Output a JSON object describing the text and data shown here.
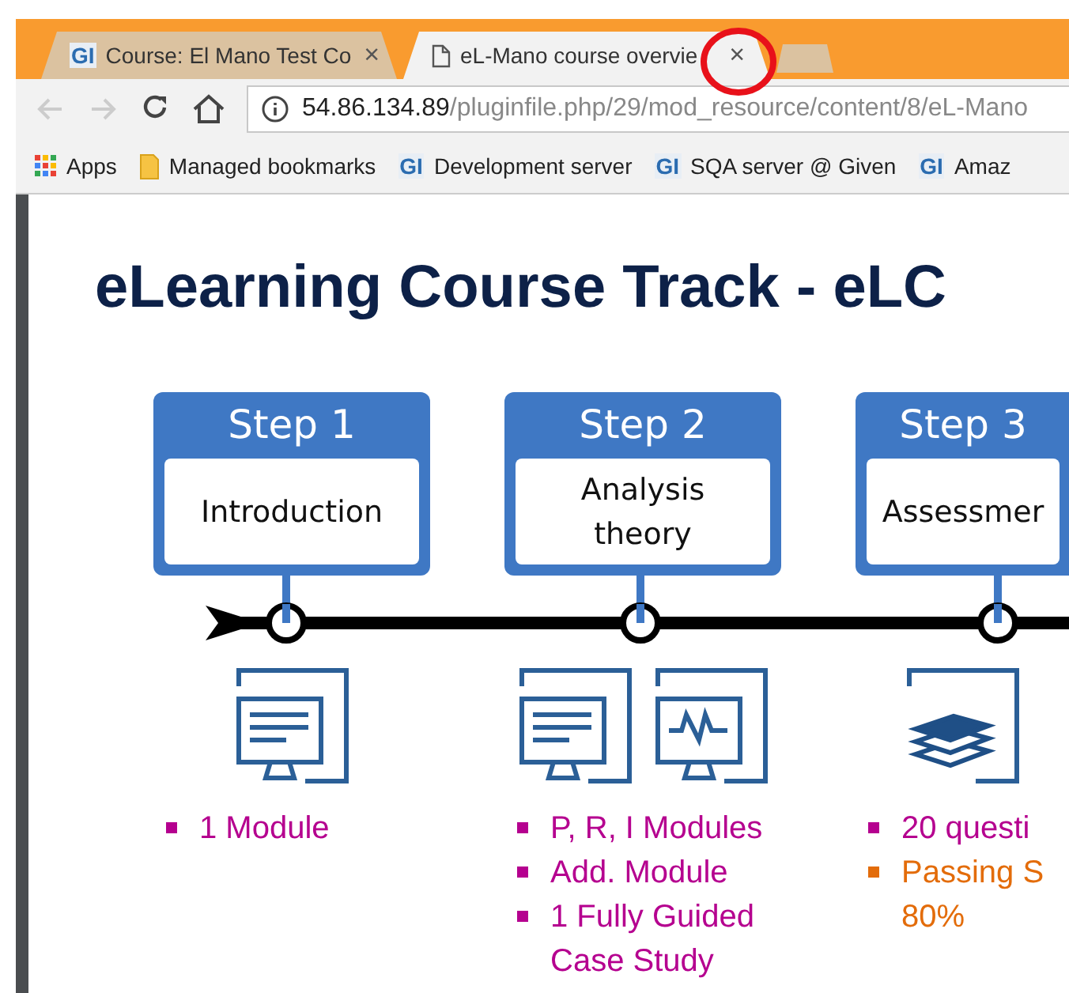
{
  "browser": {
    "tabs": [
      {
        "favicon": {
          "kind": "badge",
          "text": "GI"
        },
        "title": "Course: El Mano Test Co",
        "close": "×",
        "selected": false
      },
      {
        "favicon": {
          "kind": "page"
        },
        "title": "eL-Mano course overvie",
        "close": "×",
        "selected": true
      }
    ],
    "nav": {
      "back_disabled": true,
      "forward_disabled": true
    },
    "url": {
      "host": "54.86.134.89",
      "path": "/pluginfile.php/29/mod_resource/content/8/eL-Mano"
    },
    "bookmarks": [
      {
        "kind": "apps",
        "label": "Apps"
      },
      {
        "kind": "folder",
        "label": "Managed bookmarks"
      },
      {
        "kind": "site",
        "badge": "GI",
        "label": "Development server"
      },
      {
        "kind": "site",
        "badge": "GI",
        "label": "SQA server @ Given"
      },
      {
        "kind": "site",
        "badge": "GI",
        "label": "Amaz"
      }
    ]
  },
  "document": {
    "title": "eLearning Course Track - eLC",
    "steps": [
      {
        "step": "Step 1",
        "label": "Introduction",
        "icons": [
          {
            "kind": "document"
          }
        ],
        "items": [
          {
            "lines": [
              "1 Module"
            ],
            "color": "#b5008f"
          }
        ]
      },
      {
        "step": "Step 2",
        "label": "Analysis theory",
        "icons": [
          {
            "kind": "document"
          },
          {
            "kind": "chart"
          }
        ],
        "items": [
          {
            "lines": [
              "P, R, I Modules"
            ],
            "color": "#b5008f"
          },
          {
            "lines": [
              "Add. Module"
            ],
            "color": "#b5008f"
          },
          {
            "lines": [
              "1 Fully Guided",
              "Case Study"
            ],
            "color": "#b5008f"
          }
        ]
      },
      {
        "step": "Step 3",
        "label": "Assessmer",
        "icons": [
          {
            "kind": "books"
          }
        ],
        "items": [
          {
            "lines": [
              "20 questi"
            ],
            "color": "#b5008f"
          },
          {
            "lines": [
              "Passing S",
              "80%"
            ],
            "color": "#e36c0a"
          }
        ]
      }
    ]
  }
}
